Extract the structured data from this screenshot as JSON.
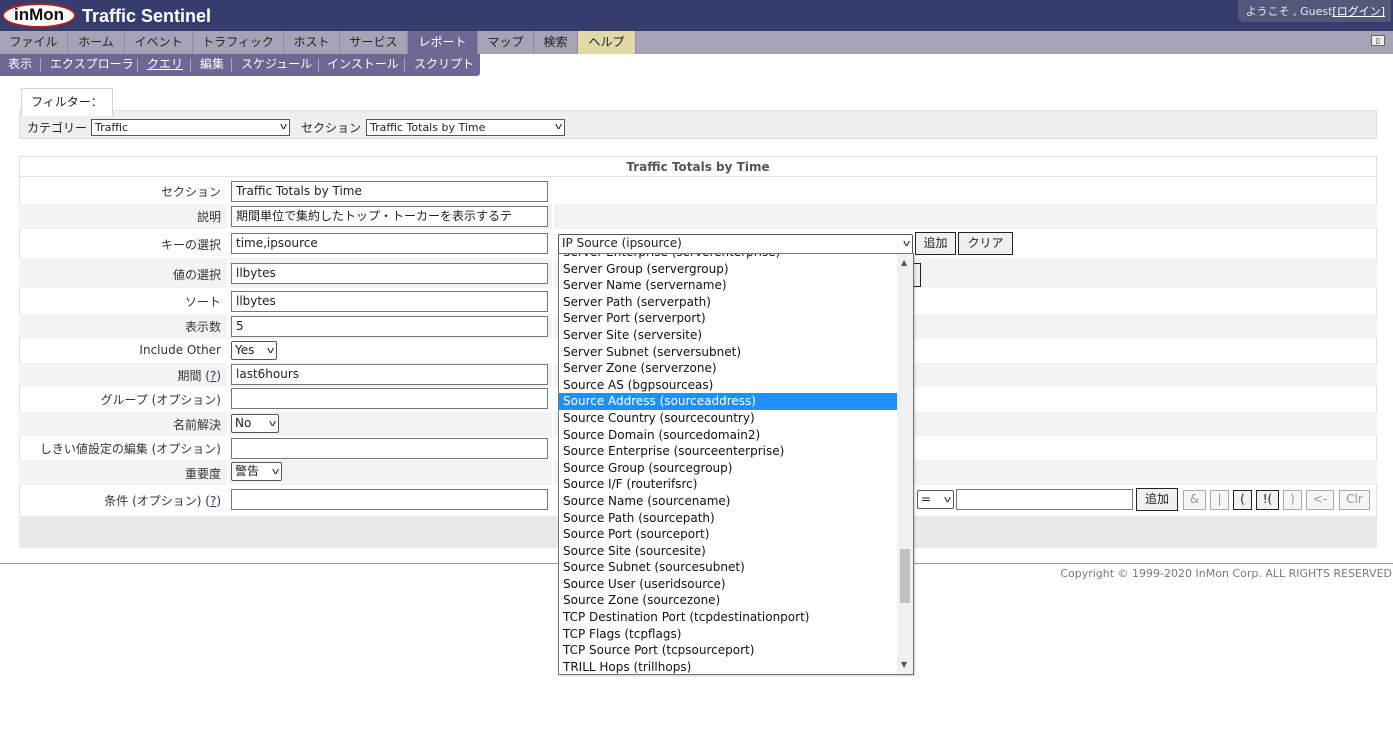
{
  "app": {
    "logo": "inMon",
    "title": "Traffic Sentinel",
    "welcome": "ようこそ , Guest",
    "login": "[ログイン]",
    "toggle": "▯"
  },
  "nav1": [
    "ファイル",
    "ホーム",
    "イベント",
    "トラフィック",
    "ホスト",
    "サービス",
    "レポート",
    "マップ",
    "検索",
    "ヘルプ"
  ],
  "nav2": [
    "表示",
    "エクスプローラ",
    "クエリ",
    "編集",
    "スケジュール",
    "インストール",
    "スクリプト"
  ],
  "filter": {
    "legend": "フィルター：",
    "category_label": "カテゴリー",
    "category_value": "Traffic",
    "section_label": "セクション",
    "section_value": "Traffic Totals by Time"
  },
  "form": {
    "title": "Traffic Totals by Time",
    "labels": {
      "section": "セクション",
      "desc": "説明",
      "keys": "キーの選択",
      "values": "値の選択",
      "sort": "ソート",
      "count": "表示数",
      "include_other": "Include Other",
      "period": "期間 (",
      "help_q": "?",
      ")": ")",
      "group": "グループ (オプション)",
      "resolve": "名前解決",
      "threshold": "しきい値設定の編集 (オプション)",
      "severity": "重要度",
      "condition": "条件 (オプション) ("
    },
    "values": {
      "section": "Traffic Totals by Time",
      "desc": "期間単位で集約したトップ・トーカーを表示するテ",
      "keys": "time,ipsource",
      "values": "llbytes",
      "sort": "llbytes",
      "count": "5",
      "include_other": "Yes",
      "period": "last6hours",
      "group": "",
      "resolve": "No",
      "threshold": "",
      "severity": "警告",
      "condition": ""
    },
    "key_select": "IP Source (ipsource)",
    "add": "追加",
    "clear": "クリア",
    "op": "=",
    "cond_buttons": [
      "追加",
      "&",
      "|",
      "(",
      "!(",
      ")",
      "<-",
      "Clr"
    ]
  },
  "dropdown": {
    "options": [
      "Server Enterprise (serverenterprise)",
      "Server Group (servergroup)",
      "Server Name (servername)",
      "Server Path (serverpath)",
      "Server Port (serverport)",
      "Server Site (serversite)",
      "Server Subnet (serversubnet)",
      "Server Zone (serverzone)",
      "Source AS (bgpsourceas)",
      "Source Address (sourceaddress)",
      "Source Country (sourcecountry)",
      "Source Domain (sourcedomain2)",
      "Source Enterprise (sourceenterprise)",
      "Source Group (sourcegroup)",
      "Source I/F (routerifsrc)",
      "Source Name (sourcename)",
      "Source Path (sourcepath)",
      "Source Port (sourceport)",
      "Source Site (sourcesite)",
      "Source Subnet (sourcesubnet)",
      "Source User (useridsource)",
      "Source Zone (sourcezone)",
      "TCP Destination Port (tcpdestinationport)",
      "TCP Flags (tcpflags)",
      "TCP Source Port (tcpsourceport)",
      "TRILL Hops (trillhops)"
    ],
    "highlighted": "Source Address (sourceaddress)"
  },
  "copyright": "Copyright © 1999-2020 InMon Corp. ALL RIGHTS RESERVED"
}
